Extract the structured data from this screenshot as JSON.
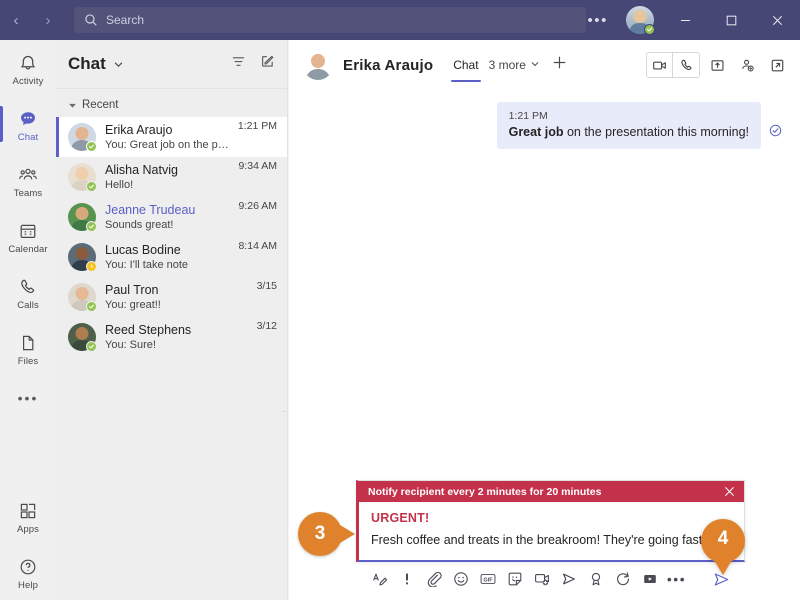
{
  "titlebar": {
    "back_label": "‹",
    "forward_label": "›",
    "search_placeholder": "Search",
    "more_label": "•••",
    "minimize_label": "minimize",
    "maximize_label": "maximize",
    "close_label": "close",
    "brand_color": "#464775",
    "presence_status": "available"
  },
  "rail": {
    "items": [
      {
        "label": "Activity",
        "icon": "bell-icon",
        "active": false
      },
      {
        "label": "Chat",
        "icon": "chat-bubble-icon",
        "active": true
      },
      {
        "label": "Teams",
        "icon": "teams-people-icon",
        "active": false
      },
      {
        "label": "Calendar",
        "icon": "calendar-icon",
        "active": false
      },
      {
        "label": "Calls",
        "icon": "phone-icon",
        "active": false
      },
      {
        "label": "Files",
        "icon": "file-icon",
        "active": false
      }
    ],
    "more_label": "•••",
    "bottom_items": [
      {
        "label": "Apps",
        "icon": "apps-grid-icon"
      },
      {
        "label": "Help",
        "icon": "help-circle-icon"
      }
    ],
    "accent_color": "#5b5fc7"
  },
  "chat_list": {
    "title": "Chat",
    "title_caret_icon": "chevron-down-icon",
    "filter_icon": "filter-icon",
    "compose_icon": "new-chat-icon",
    "section_label": "Recent",
    "section_caret_icon": "chevron-down-icon",
    "items": [
      {
        "name": "Erika Araujo",
        "preview": "You: Great job on the presentati...",
        "time": "1:21 PM",
        "presence": "available",
        "selected": true,
        "unread": false,
        "skin": "#e3b48f",
        "shirt": "#8e9aa5",
        "bg": "#cfd8e3"
      },
      {
        "name": "Alisha Natvig",
        "preview": "Hello!",
        "time": "9:34 AM",
        "presence": "available",
        "selected": false,
        "unread": false,
        "skin": "#f0cfae",
        "shirt": "#dcd3c4",
        "bg": "#e8dfd2"
      },
      {
        "name": "Jeanne Trudeau",
        "preview": "Sounds great!",
        "time": "9:26 AM",
        "presence": "available",
        "selected": false,
        "unread": true,
        "skin": "#d9a97e",
        "shirt": "#3d7a46",
        "bg": "#55934f"
      },
      {
        "name": "Lucas Bodine",
        "preview": "You: I'll take note",
        "time": "8:14 AM",
        "presence": "away",
        "selected": false,
        "unread": false,
        "skin": "#8a5c3d",
        "shirt": "#2f3d4d",
        "bg": "#5a6b7a"
      },
      {
        "name": "Paul Tron",
        "preview": "You: great!!",
        "time": "3/15",
        "presence": "available",
        "selected": false,
        "unread": false,
        "skin": "#e6b894",
        "shirt": "#cfc9bd",
        "bg": "#ded7cc"
      },
      {
        "name": "Reed Stephens",
        "preview": "You: Sure!",
        "time": "3/12",
        "presence": "available",
        "selected": false,
        "unread": false,
        "skin": "#b07d52",
        "shirt": "#3a4a3c",
        "bg": "#4e5f4a"
      }
    ]
  },
  "conversation": {
    "contact_name": "Erika Araujo",
    "tabs": [
      {
        "label": "Chat",
        "active": true
      }
    ],
    "more_tabs_label": "3 more",
    "more_tabs_caret_icon": "chevron-down-icon",
    "add_tab_icon": "plus-icon",
    "actions": [
      {
        "name": "video-call-icon"
      },
      {
        "name": "audio-call-icon"
      },
      {
        "name": "share-screen-icon"
      },
      {
        "name": "add-people-icon"
      },
      {
        "name": "popout-icon"
      }
    ],
    "messages": [
      {
        "time": "1:21 PM",
        "body_bold": "Great job",
        "body_rest": " on the presentation this morning!",
        "status_icon": "seen-check-icon",
        "outgoing": true
      }
    ]
  },
  "compose": {
    "notify_banner": "Notify recipient every 2 minutes for 20 minutes",
    "notify_close_icon": "close-icon",
    "urgent_label": "URGENT!",
    "message_text": "Fresh coffee and treats in the breakroom! They're going fast!",
    "urgent_color": "#c4314b",
    "accent_color": "#5b5fc7",
    "toolbar": [
      {
        "name": "format-icon"
      },
      {
        "name": "importance-icon"
      },
      {
        "name": "attach-icon"
      },
      {
        "name": "emoji-icon"
      },
      {
        "name": "gif-icon"
      },
      {
        "name": "sticker-icon"
      },
      {
        "name": "meet-now-icon"
      },
      {
        "name": "stream-icon"
      },
      {
        "name": "praise-icon"
      },
      {
        "name": "loop-icon"
      },
      {
        "name": "video-clip-icon"
      },
      {
        "name": "more-options-icon"
      }
    ],
    "more_label": "•••",
    "send_icon": "send-icon"
  },
  "callouts": [
    {
      "number": "3",
      "color": "#e0822c",
      "points": "right"
    },
    {
      "number": "4",
      "color": "#e0822c",
      "points": "down"
    }
  ]
}
